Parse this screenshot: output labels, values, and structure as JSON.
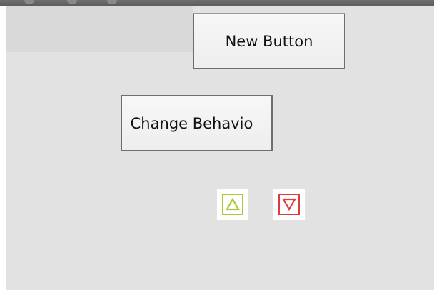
{
  "buttons": {
    "new_button_label": "New Button",
    "change_behavior_label": "Change Behavio"
  },
  "icons": {
    "increase": "triangle-up-icon",
    "decrease": "triangle-down-icon"
  },
  "colors": {
    "background": "#e2e2e2",
    "increase_accent": "#a9c93a",
    "decrease_accent": "#e03b3b",
    "button_border": "#6e6e6e"
  }
}
